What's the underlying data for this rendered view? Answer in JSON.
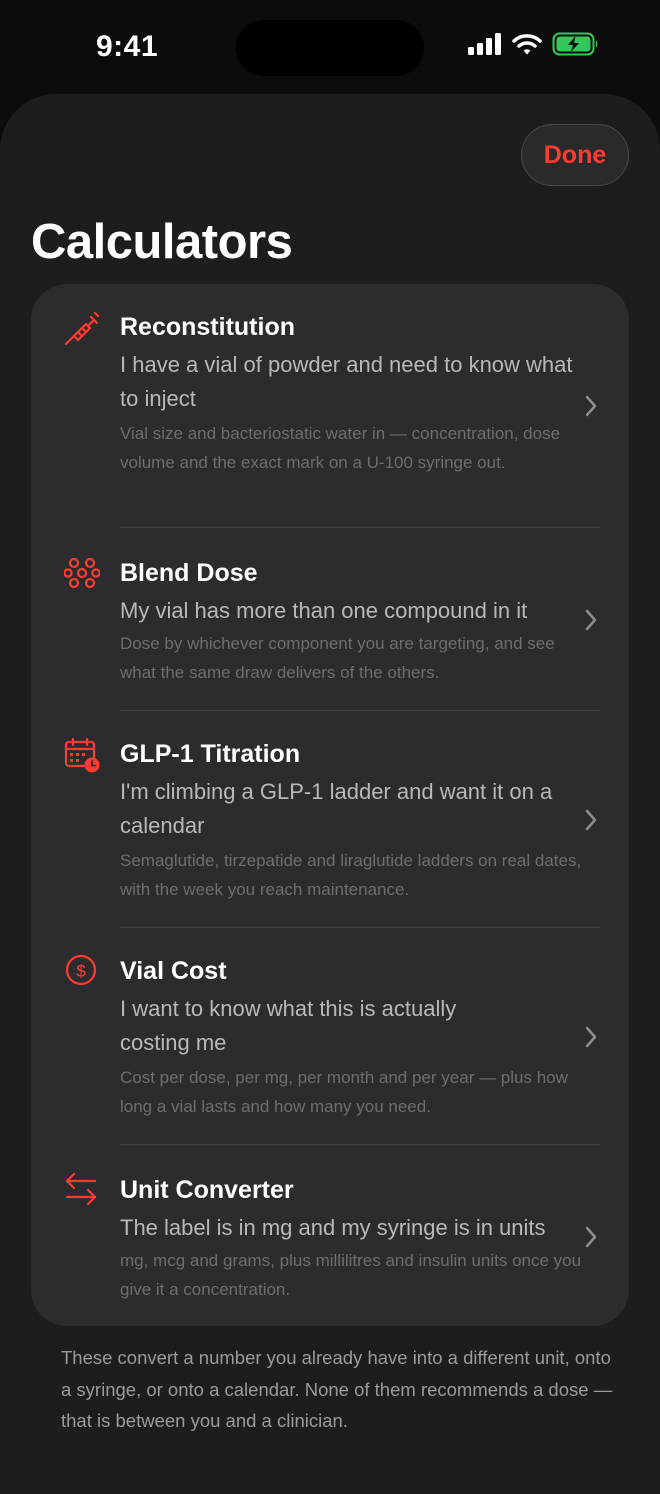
{
  "status_bar": {
    "time": "9:41"
  },
  "header": {
    "done_label": "Done",
    "title": "Calculators"
  },
  "calculators": [
    {
      "icon": "syringe-icon",
      "title": "Reconstitution",
      "subtitle": "I have a vial of powder and need to know what to inject",
      "description": "Vial size and bacteriostatic water in — concentration, dose volume and the exact mark on a U-100 syringe out."
    },
    {
      "icon": "blend-icon",
      "title": "Blend Dose",
      "subtitle": "My vial has more than one compound in it",
      "description": "Dose by whichever component you are targeting, and see what the same draw delivers of the others."
    },
    {
      "icon": "calendar-clock-icon",
      "title": "GLP-1 Titration",
      "subtitle": "I'm climbing a GLP-1 ladder and want it on a calendar",
      "description": "Semaglutide, tirzepatide and liraglutide ladders on real dates, with the week you reach maintenance."
    },
    {
      "icon": "dollar-circle-icon",
      "title": "Vial Cost",
      "subtitle": "I want to know what this is actually costing me",
      "description": "Cost per dose, per mg, per month and per year — plus how long a vial lasts and how many you need."
    },
    {
      "icon": "arrows-exchange-icon",
      "title": "Unit Converter",
      "subtitle": "The label is in mg and my syringe is in units",
      "description": "mg, mcg and grams, plus millilitres and insulin units once you give it a concentration."
    }
  ],
  "footer": {
    "text": "These convert a number you already have into a different unit, onto a syringe, or onto a calendar. None of them recommends a dose — that is between you and a clinician."
  },
  "colors": {
    "accent": "#ff3b30",
    "background": "#1d1d1f",
    "card": "#2c2c2e",
    "battery": "#34c759"
  }
}
